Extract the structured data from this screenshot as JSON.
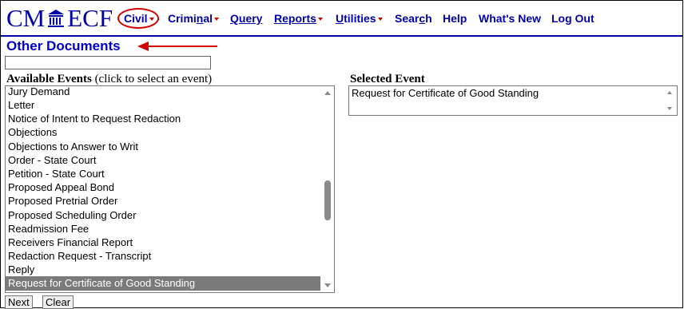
{
  "logo": {
    "left": "CM",
    "right": "ECF"
  },
  "menu": {
    "civil": "Civil",
    "criminal_pre": "Crimi",
    "criminal_u": "n",
    "criminal_post": "al",
    "query": "Query",
    "reports": "Reports",
    "utilities_u": "U",
    "utilities_post": "tilities",
    "search_pre": "Sear",
    "search_u": "c",
    "search_post": "h",
    "help": "Help",
    "whats_new": "What's New",
    "logout": "Log Out"
  },
  "accent_colors": {
    "link": "#0000aa",
    "annotation": "#d40000",
    "selected_bg": "#7a7a7a"
  },
  "page_title": "Other Documents",
  "available_label": "Available Events",
  "available_note": "(click to select an event)",
  "selected_label": "Selected Event",
  "available_events": [
    "Jury Demand",
    "Letter",
    "Notice of Intent to Request Redaction",
    "Objections",
    "Objections to Answer to Writ",
    "Order - State Court",
    "Petition - State Court",
    "Proposed Appeal Bond",
    "Proposed Pretrial Order",
    "Proposed Scheduling Order",
    "Readmission Fee",
    "Receivers Financial Report",
    "Redaction Request - Transcript",
    "Reply",
    "Request for Certificate of Good Standing"
  ],
  "selected_event": "Request for Certificate of Good Standing",
  "buttons": {
    "next": "Next",
    "clear": "Clear"
  }
}
